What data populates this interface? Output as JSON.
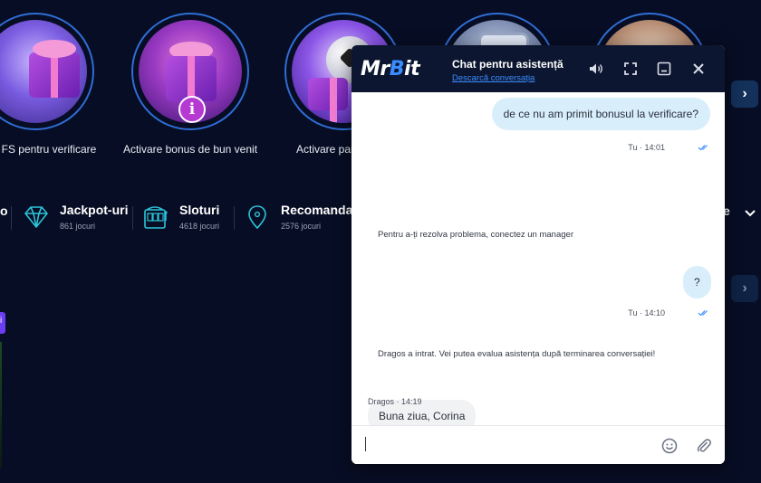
{
  "stories": [
    {
      "label": "FS pentru verificare"
    },
    {
      "label": "Activare bonus de bun venit"
    },
    {
      "label": "Activare par"
    }
  ],
  "categories": [
    {
      "title": "Jackpot-uri",
      "count": "861 jocuri",
      "icon": "diamond-icon"
    },
    {
      "title": "Sloturi",
      "count": "4618 jocuri",
      "icon": "slot-machine-icon"
    },
    {
      "title": "Recomandat",
      "count": "2576 jocuri",
      "icon": "location-pin-icon"
    }
  ],
  "fragments": {
    "left_cat": "o",
    "right_cat": "e",
    "left_badge": "i"
  },
  "chat": {
    "brand_mr": "Mr",
    "brand_b": "B",
    "brand_it": "it",
    "title": "Chat pentru asistență",
    "download_link": "Descarcă conversația",
    "messages": {
      "user1": "de ce nu am primit bonusul la verificare?",
      "user1_meta": "Tu · 14:01",
      "system1": "Pentru a-ți rezolva problema, conectez un manager",
      "user2": "?",
      "user2_meta": "Tu · 14:10",
      "system2": "Dragos a intrat. Vei putea evalua asistența după terminarea conversației!",
      "agent1": "Buna ziua, Corina",
      "agent1_meta": "Dragos · 14:19"
    },
    "input_value": "",
    "colors": {
      "header_bg": "#0d1630",
      "accent": "#3a8dff",
      "user_bubble": "#d8eefb"
    }
  }
}
